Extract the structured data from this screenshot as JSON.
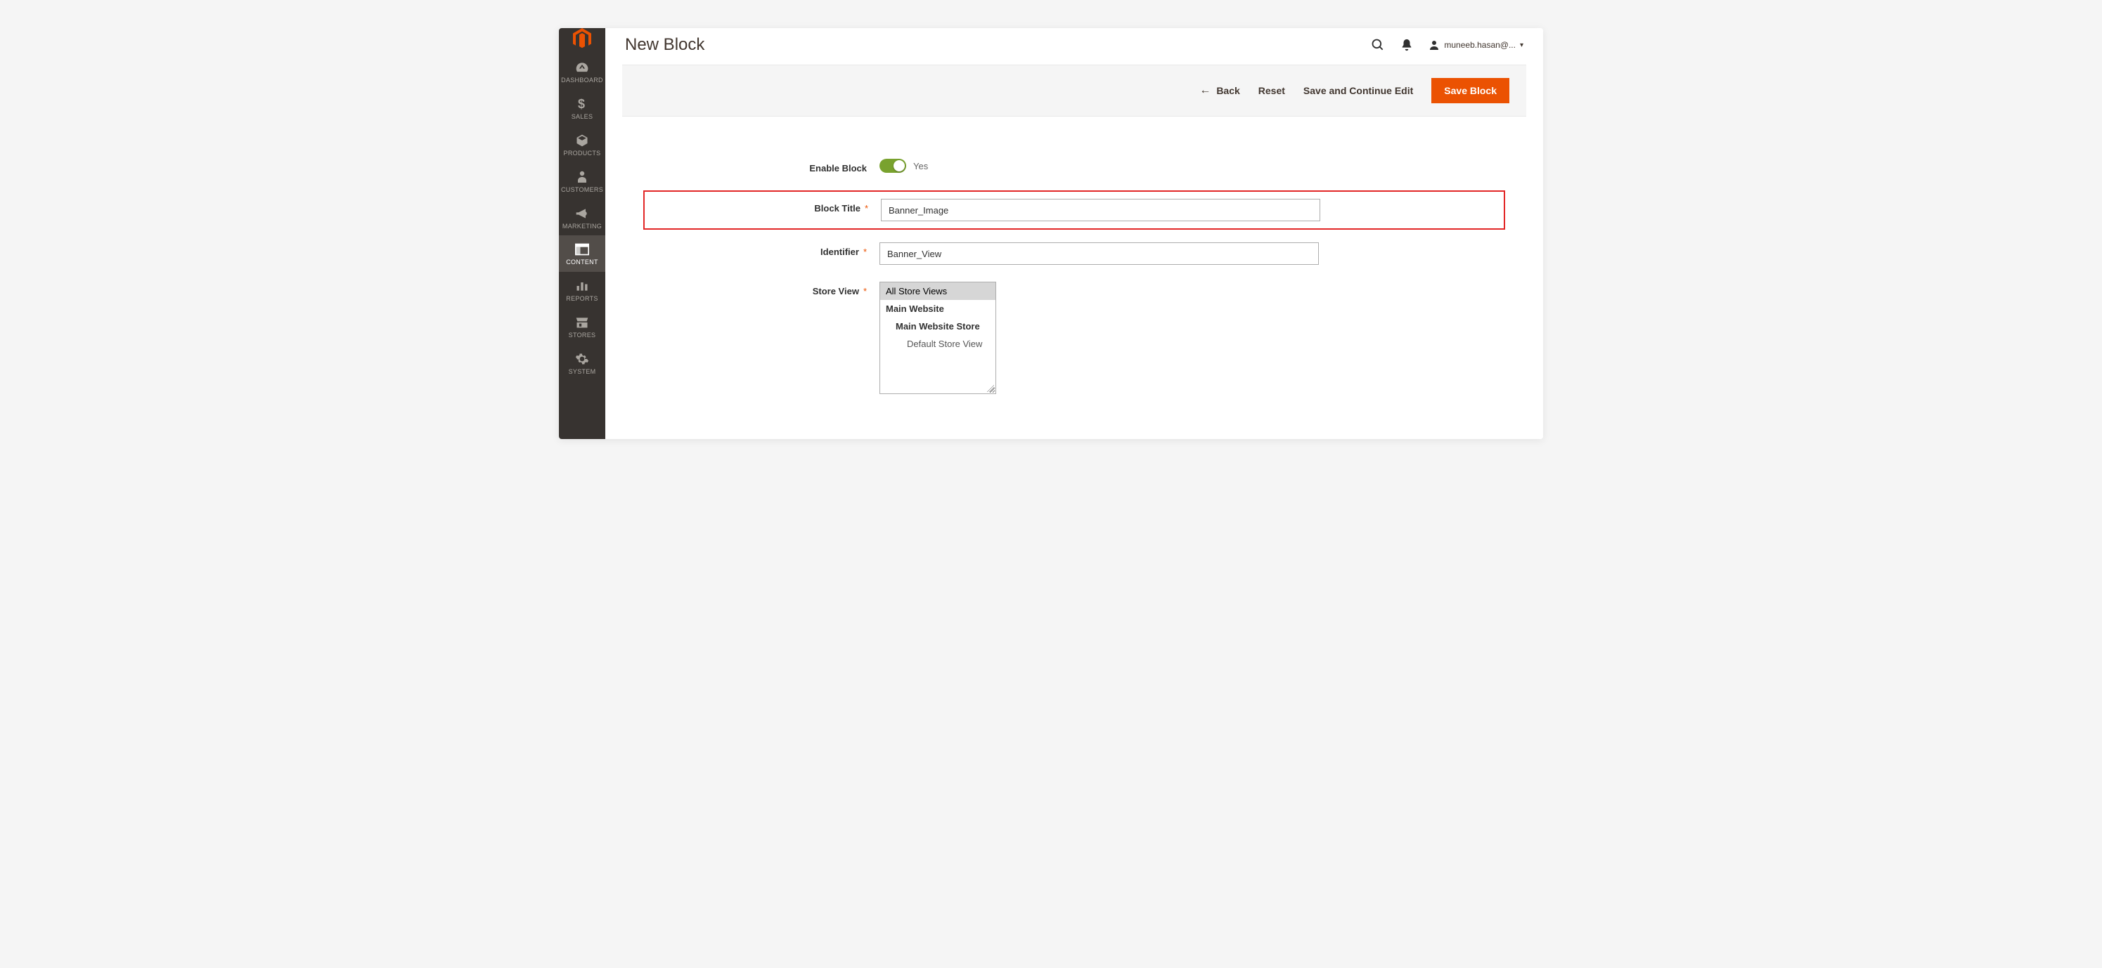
{
  "header": {
    "page_title": "New Block",
    "user_display": "muneeb.hasan@..."
  },
  "sidebar": {
    "items": [
      {
        "id": "dashboard",
        "label": "DASHBOARD",
        "icon": "gauge-icon"
      },
      {
        "id": "sales",
        "label": "SALES",
        "icon": "dollar-icon"
      },
      {
        "id": "products",
        "label": "PRODUCTS",
        "icon": "box-icon"
      },
      {
        "id": "customers",
        "label": "CUSTOMERS",
        "icon": "person-icon"
      },
      {
        "id": "marketing",
        "label": "MARKETING",
        "icon": "megaphone-icon"
      },
      {
        "id": "content",
        "label": "CONTENT",
        "icon": "layout-icon",
        "active": true
      },
      {
        "id": "reports",
        "label": "REPORTS",
        "icon": "barchart-icon"
      },
      {
        "id": "stores",
        "label": "STORES",
        "icon": "storefront-icon"
      },
      {
        "id": "system",
        "label": "SYSTEM",
        "icon": "gear-icon"
      }
    ]
  },
  "actionbar": {
    "back_label": "Back",
    "reset_label": "Reset",
    "save_continue_label": "Save and Continue Edit",
    "save_label": "Save Block"
  },
  "form": {
    "enable_block": {
      "label": "Enable Block",
      "value": true,
      "value_text": "Yes"
    },
    "block_title": {
      "label": "Block Title",
      "value": "Banner_Image",
      "required": true,
      "highlighted": true
    },
    "identifier": {
      "label": "Identifier",
      "value": "Banner_View",
      "required": true
    },
    "store_view": {
      "label": "Store View",
      "required": true,
      "options": [
        {
          "label": "All Store Views",
          "level": 0,
          "selected": true
        },
        {
          "label": "Main Website",
          "level": 1
        },
        {
          "label": "Main Website Store",
          "level": 2
        },
        {
          "label": "Default Store View",
          "level": 3
        }
      ]
    }
  },
  "colors": {
    "accent": "#eb5202",
    "toggle_on": "#79a22e",
    "sidebar_bg": "#373330"
  }
}
